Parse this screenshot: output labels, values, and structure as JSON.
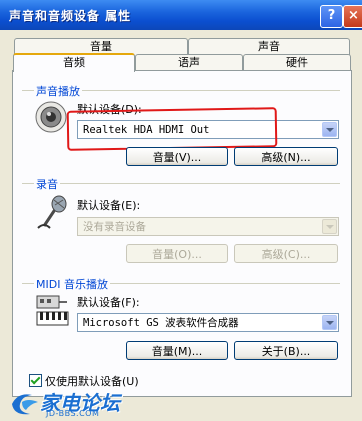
{
  "window": {
    "title": "声音和音频设备 属性",
    "help_label": "?",
    "close_label": "×"
  },
  "tabs": {
    "row1": [
      "音量",
      "声音"
    ],
    "row2": [
      "音频",
      "语声",
      "硬件"
    ],
    "selected": "音频"
  },
  "playback": {
    "group_label": "声音播放",
    "default_device_label": "默认设备(D):",
    "selected_device": "Realtek HDA HDMI Out",
    "volume_button": "音量(V)...",
    "advanced_button": "高级(N)..."
  },
  "recording": {
    "group_label": "录音",
    "default_device_label": "默认设备(E):",
    "selected_device": "没有录音设备",
    "volume_button": "音量(O)...",
    "advanced_button": "高级(C)..."
  },
  "midi": {
    "group_label": "MIDI 音乐播放",
    "default_device_label": "默认设备(F):",
    "selected_device": "Microsoft GS 波表软件合成器",
    "volume_button": "音量(M)...",
    "about_button": "关于(B)..."
  },
  "only_default_checkbox": {
    "label": "仅使用默认设备(U)",
    "checked": true
  },
  "watermark": {
    "main": "家电论坛",
    "sub": "JD-BBS.COM"
  },
  "colors": {
    "group_label": "#0046d5",
    "highlight_box": "#e01818",
    "titlebar": "#0c47b8"
  }
}
